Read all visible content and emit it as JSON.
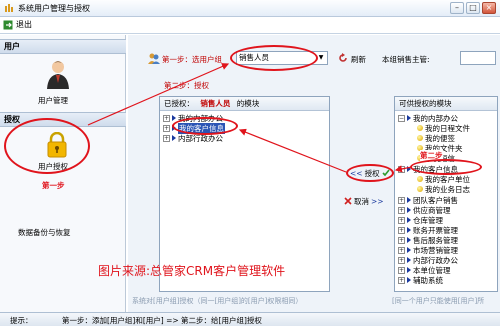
{
  "window": {
    "title": "系统用户管理与授权",
    "minimize": "–",
    "maximize": "□",
    "close": "×"
  },
  "menu": {
    "exit_label": "退出"
  },
  "sidebar": {
    "users_header": "用户",
    "user_mgmt_label": "用户管理",
    "auth_header": "授权",
    "user_auth_label": "用户授权",
    "step_one_label": "第一步",
    "backup_label": "数据备份与恢复"
  },
  "controls": {
    "step_one_text": "第一步：选用户组",
    "group_value": "销售人员",
    "refresh_label": "刷新",
    "manager_label": "本组销售主管:",
    "step_two_text": "第二步：授权"
  },
  "authorized": {
    "prefix": "已授权：",
    "group_name": "销售人员",
    "suffix": "的模块",
    "items": [
      "我的内部办公",
      "我的客户信息",
      "内部行政办公"
    ]
  },
  "available": {
    "header": "可供授权的模块",
    "items": [
      "我的内部办公",
      "我的日程文件",
      "我的便签",
      "我的文件夹",
      "手机短信",
      "我的客户信息",
      "我的客户单位",
      "我的业务日志",
      "团队客户销售",
      "供应商管理",
      "仓库管理",
      "账务开票管理",
      "售后服务管理",
      "市场营销管理",
      "内部行政办公",
      "本单位管理",
      "辅助系统"
    ],
    "step_label": "第二步"
  },
  "buttons": {
    "grant_label": "授权",
    "cancel_label": "取消",
    "grant_arrows": "<<",
    "cancel_arrows": ">>"
  },
  "watermark": "图片来源:总管家CRM客户管理软件",
  "footnotes": {
    "left_note": "系统对[用户组]授权（同一[用户组]的[用户]权限相同）",
    "right_note": "[同一个用户只能使用[用户]所"
  },
  "status": {
    "hint_label": "提示：",
    "hint_text": "第一步：添加[用户组]和[用户]  =>  第二步：给[用户组]授权"
  },
  "colors": {
    "annotation_red": "#e0141c",
    "tree_bullet": "#1a3a9e",
    "panel_bg": "#eef3f9"
  }
}
